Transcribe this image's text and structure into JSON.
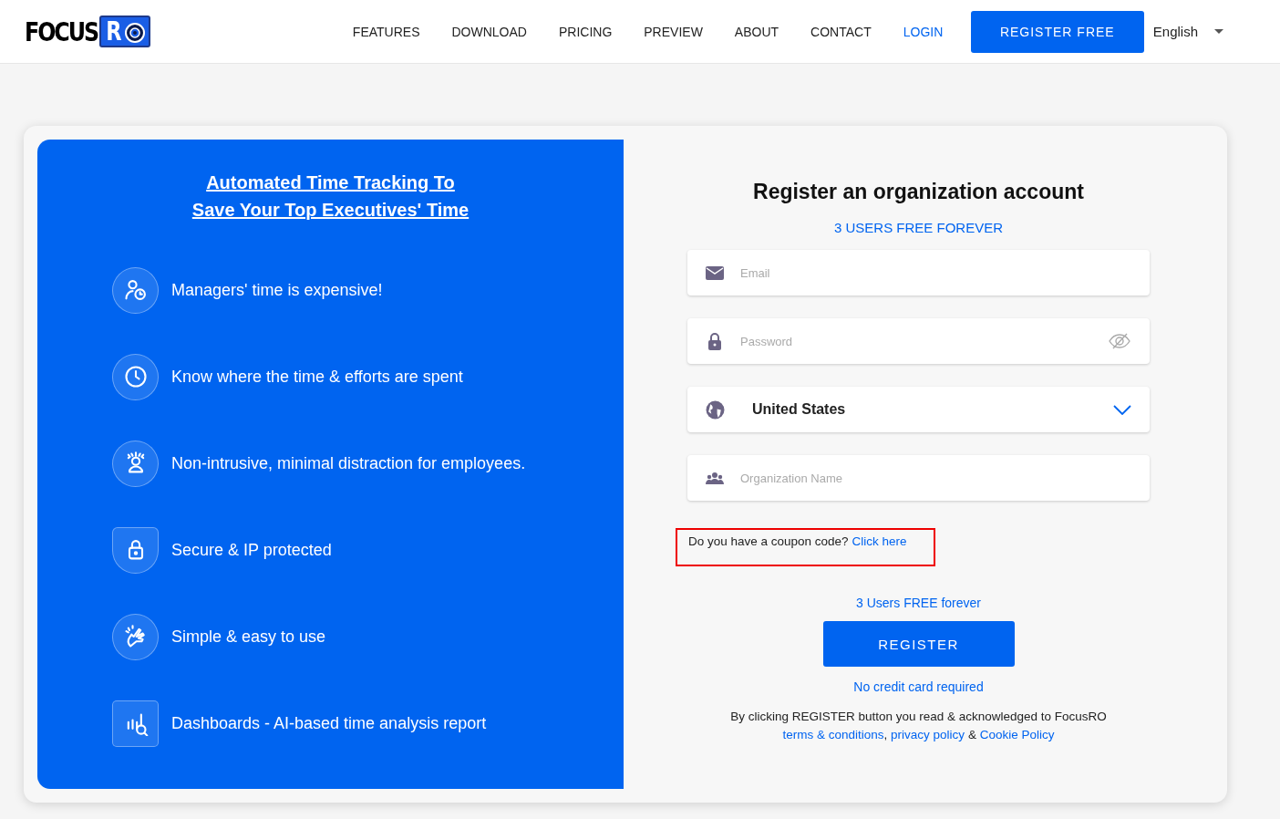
{
  "header": {
    "logo": {
      "text": "FOCUS",
      "badge": "R"
    },
    "nav": [
      {
        "label": "FEATURES",
        "selected": false
      },
      {
        "label": "DOWNLOAD",
        "selected": false
      },
      {
        "label": "PRICING",
        "selected": false
      },
      {
        "label": "PREVIEW",
        "selected": false
      },
      {
        "label": "ABOUT",
        "selected": false
      },
      {
        "label": "CONTACT",
        "selected": false
      },
      {
        "label": "LOGIN",
        "selected": true
      }
    ],
    "cta": "REGISTER FREE",
    "language": "English"
  },
  "promo": {
    "title_lines": [
      "Automated Time Tracking To",
      "Save Your Top Executives' Time"
    ],
    "features": [
      "Managers' time is expensive!",
      "Know where the time & efforts are spent",
      "Non-intrusive, minimal distraction for employees.",
      "Secure & IP protected",
      "Simple & easy to use",
      "Dashboards - AI-based time analysis report"
    ]
  },
  "form": {
    "title": "Register an organization account",
    "subtitle": "3 USERS FREE FOREVER",
    "email": {
      "placeholder": "Email"
    },
    "password": {
      "placeholder": "Password"
    },
    "country": {
      "value": "United States"
    },
    "organization": {
      "placeholder": "Organization Name"
    },
    "coupon": {
      "prompt": "Do you have a coupon code?",
      "link": "Click here"
    },
    "free_note": "3 Users FREE forever",
    "submit": "REGISTER",
    "card_note": "No credit card required",
    "consent": {
      "text": "By clicking REGISTER button you read & acknowledged to FocusRO",
      "terms": "terms & conditions",
      "sep": ",",
      "privacy": "privacy policy",
      "amp": "&",
      "cookie": "Cookie Policy"
    }
  }
}
